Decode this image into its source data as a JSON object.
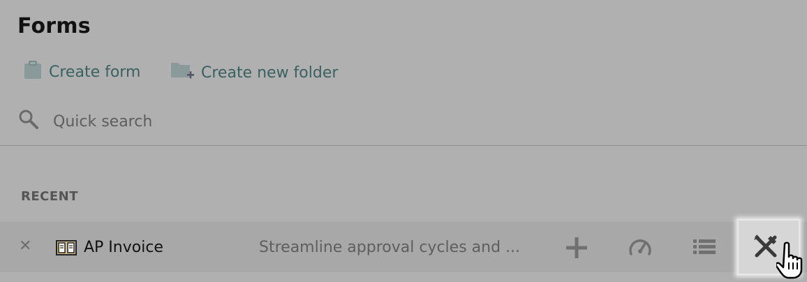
{
  "page": {
    "title": "Forms"
  },
  "actions": {
    "create_form": {
      "label": "Create form",
      "icon": "clipboard-icon"
    },
    "create_folder": {
      "label": "Create new folder",
      "icon": "folder-add-icon"
    }
  },
  "search": {
    "placeholder": "Quick search",
    "icon": "search-icon"
  },
  "recent": {
    "label": "RECENT",
    "items": [
      {
        "name": "AP Invoice",
        "description": "Streamline approval cycles and ...",
        "icons": [
          "close-icon",
          "form-icon",
          "plus-icon",
          "dashboard-gauge-icon",
          "list-icon",
          "tools-icon"
        ]
      }
    ]
  },
  "colors": {
    "background": "#b0b0b0",
    "row_background": "#a8a8a8",
    "link": "#3b6060",
    "highlight": "#d6d6d6"
  }
}
